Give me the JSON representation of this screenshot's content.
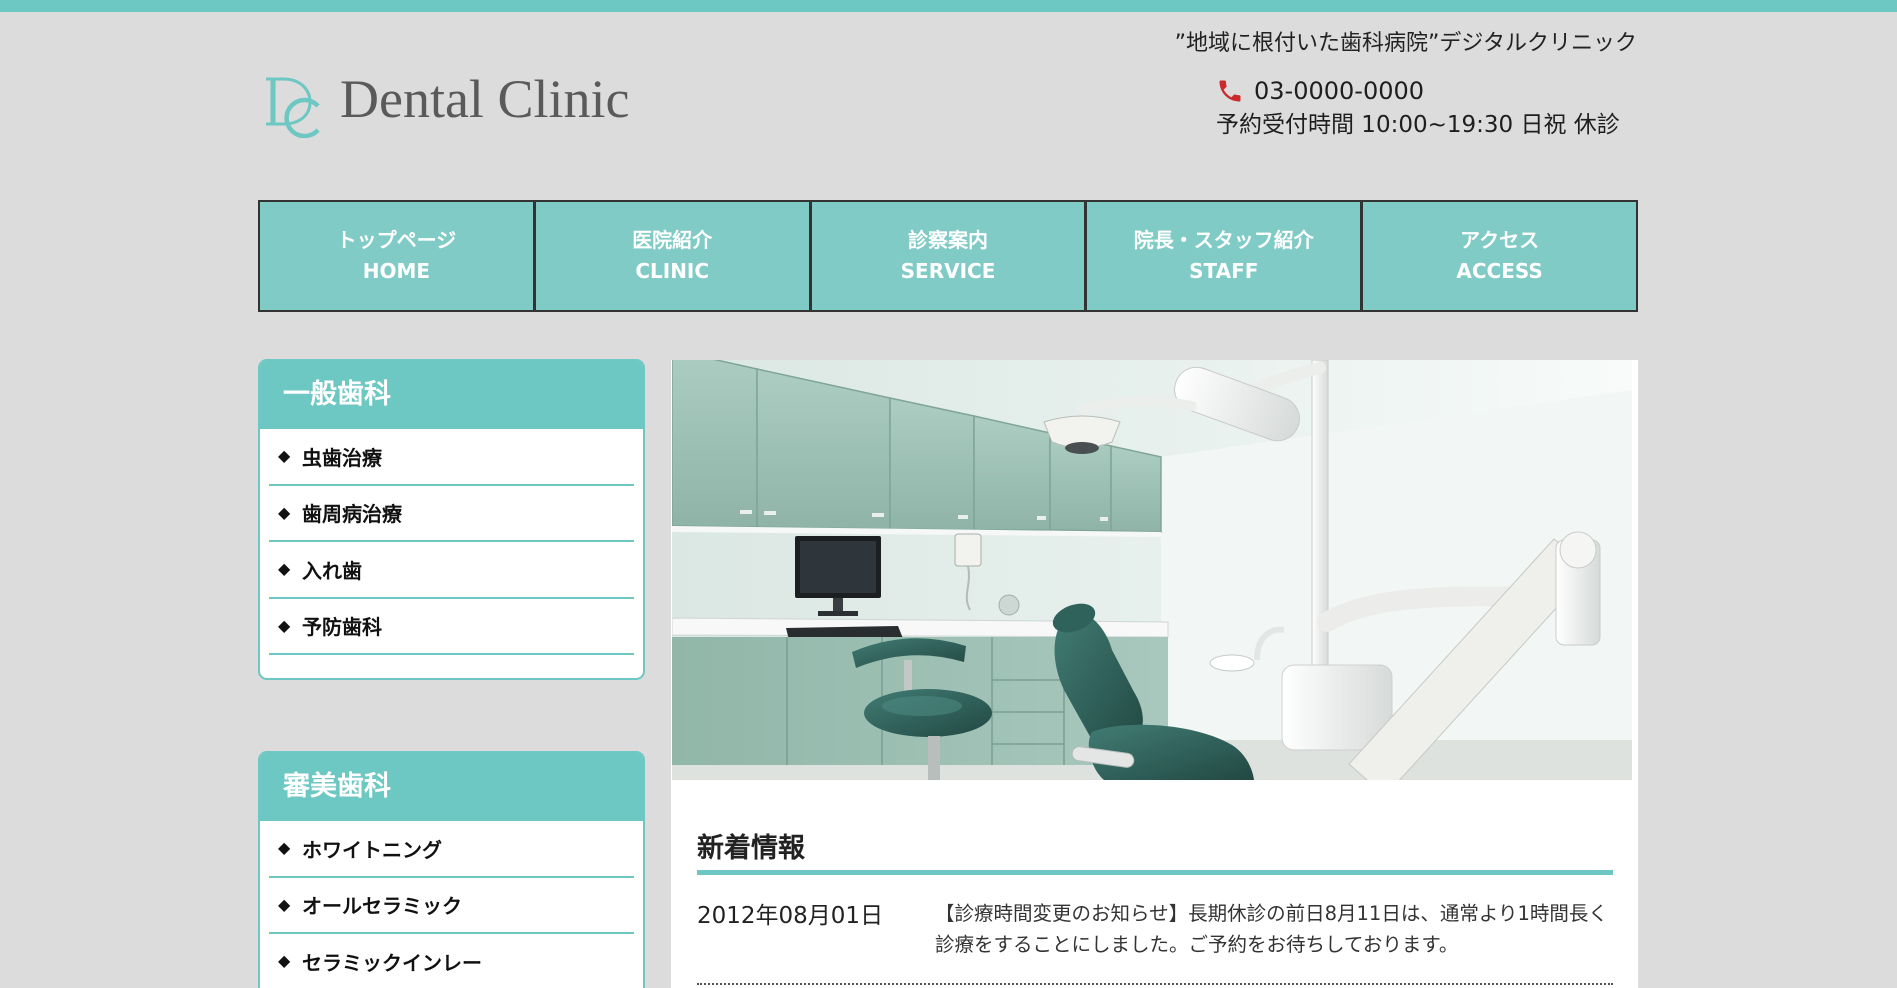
{
  "header": {
    "tagline": "”地域に根付いた歯科病院”デジタルクリニック",
    "logo": {
      "monogram": "DC",
      "name": "Dental Clinic"
    },
    "phone": {
      "icon": "phone-icon",
      "number": "03-0000-0000"
    },
    "hours": "予約受付時間 10:00~19:30 日祝 休診"
  },
  "nav": {
    "items": [
      {
        "ja": "トップページ",
        "en": "HOME"
      },
      {
        "ja": "医院紹介",
        "en": "CLINIC"
      },
      {
        "ja": "診察案内",
        "en": "SERVICE"
      },
      {
        "ja": "院長・スタッフ紹介",
        "en": "STAFF"
      },
      {
        "ja": "アクセス",
        "en": "ACCESS"
      }
    ]
  },
  "sidebar": {
    "bullet": "◆",
    "sections": [
      {
        "title": "一般歯科",
        "items": [
          "虫歯治療",
          "歯周病治療",
          "入れ歯",
          "予防歯科"
        ]
      },
      {
        "title": "審美歯科",
        "items": [
          "ホワイトニング",
          "オールセラミック",
          "セラミックインレー"
        ]
      }
    ]
  },
  "main": {
    "news": {
      "title": "新着情報",
      "items": [
        {
          "date": "2012年08月01日",
          "text": "【診療時間変更のお知らせ】長期休診の前日8月11日は、通常より1時間長く診療をすることにしました。ご予約をお待ちしております。"
        }
      ]
    }
  },
  "colors": {
    "accent": "#6dc7c2",
    "nav_background": "#80cbc6",
    "nav_border": "#333333",
    "page_background": "#dcdcdc",
    "phone_icon": "#cc2a2a",
    "text": "#1e1e1e"
  }
}
